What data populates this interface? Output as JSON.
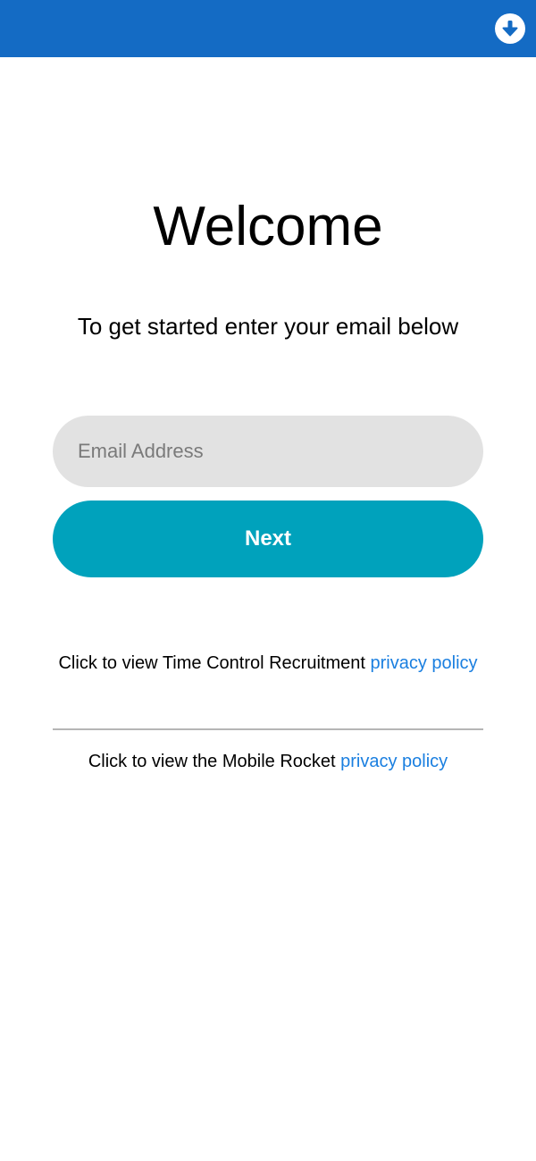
{
  "header": {
    "background_color": "#146bc4",
    "download_icon": "arrow-down-circle-icon"
  },
  "main": {
    "title": "Welcome",
    "subtitle": "To get started enter your email below",
    "email_input": {
      "placeholder": "Email Address",
      "value": ""
    },
    "next_button": {
      "label": "Next",
      "color": "#00a2bc"
    }
  },
  "policies": {
    "first": {
      "text": "Click to view Time Control Recruitment ",
      "link": "privacy policy"
    },
    "second": {
      "text": "Click to view the Mobile Rocket ",
      "link": "privacy policy"
    },
    "link_color": "#1a7fe0"
  }
}
